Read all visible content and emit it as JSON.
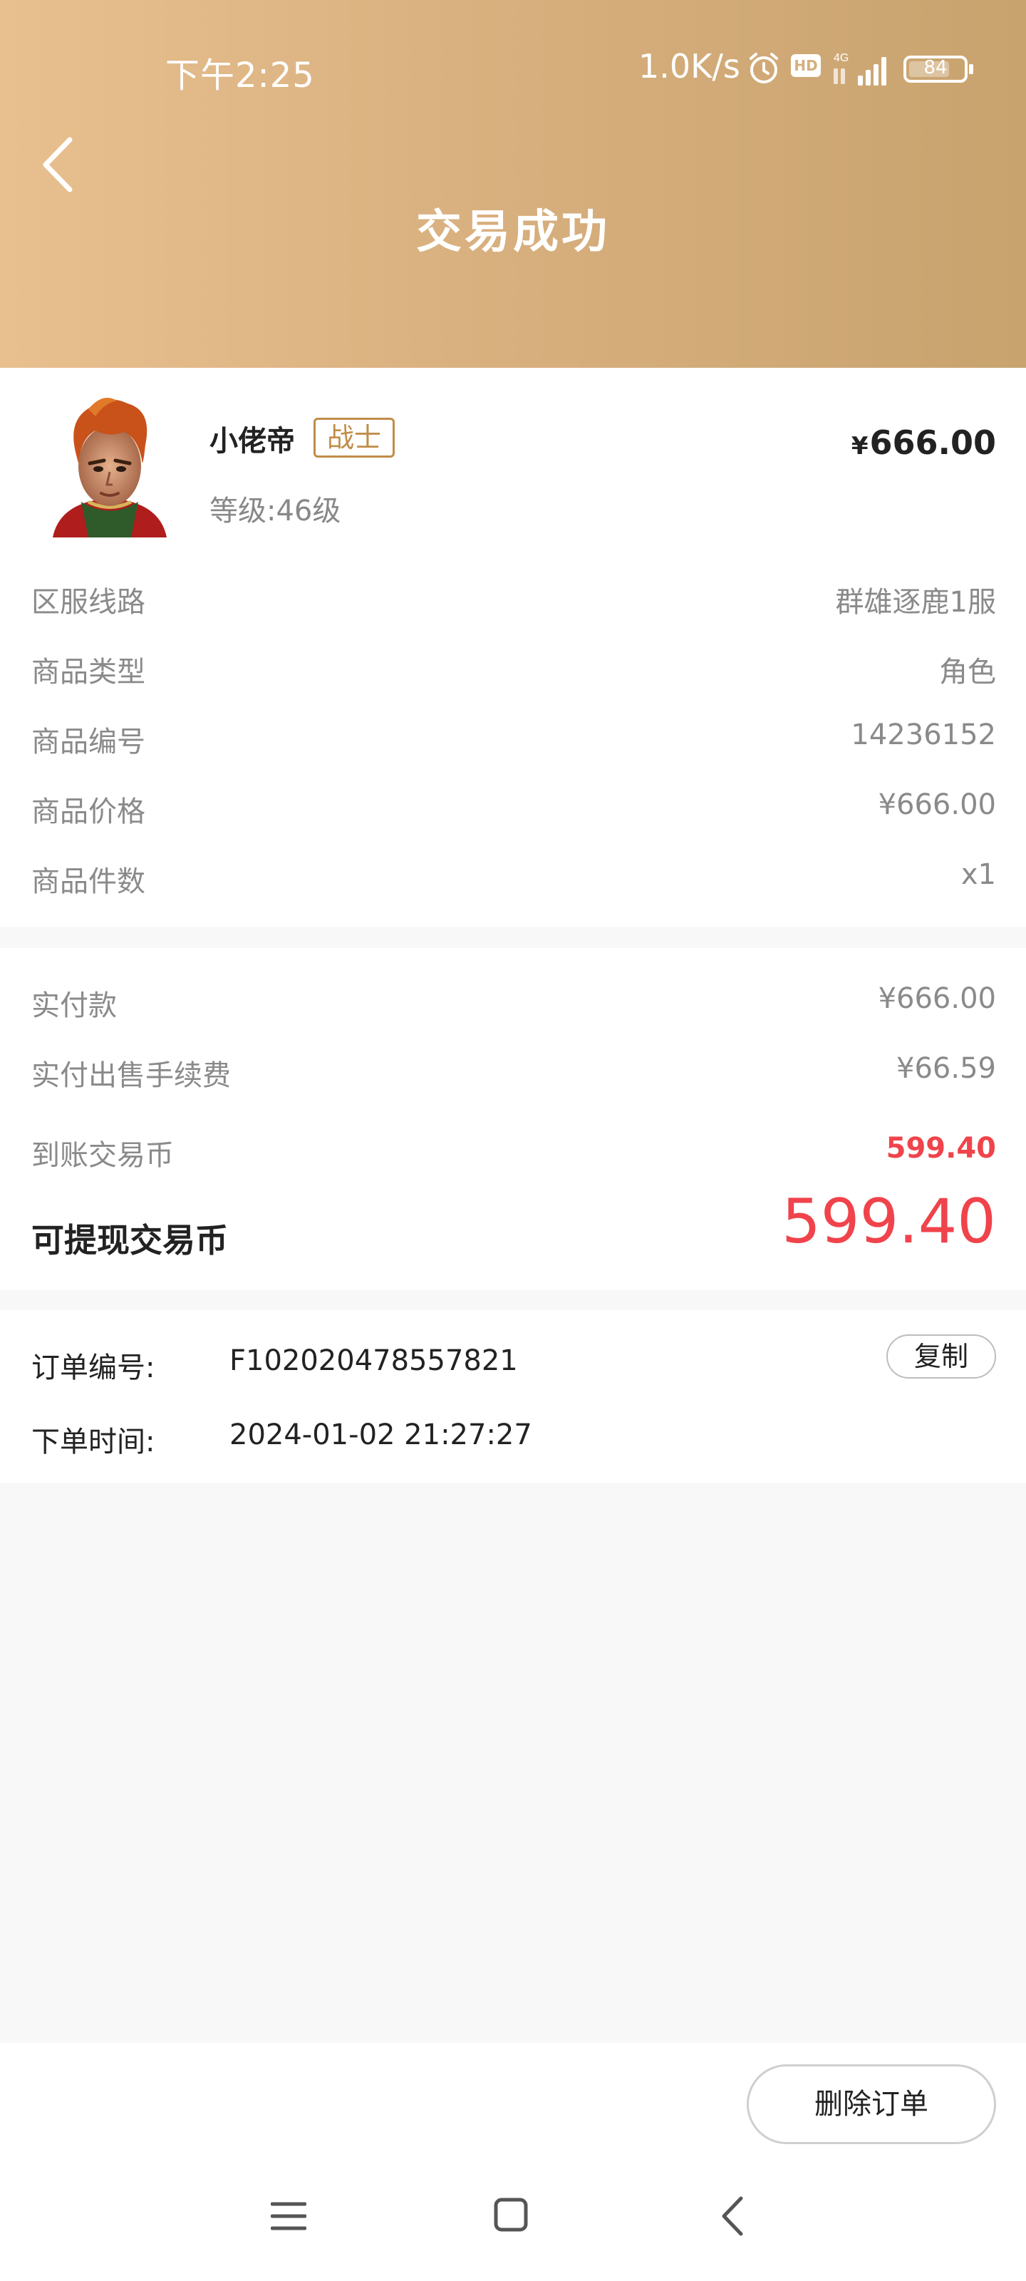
{
  "status_bar": {
    "time": "下午2:25",
    "net_speed": "1.0K/s",
    "hd_label": "HD",
    "network_label": "4G",
    "battery": "84"
  },
  "header": {
    "title": "交易成功"
  },
  "product": {
    "role_name": "小佬帝",
    "class_badge": "战士",
    "level": "等级:46级",
    "price_symbol": "¥",
    "price": "666.00",
    "details": [
      {
        "label": "区服线路",
        "value": "群雄逐鹿1服"
      },
      {
        "label": "商品类型",
        "value": "角色"
      },
      {
        "label": "商品编号",
        "value": "14236152"
      },
      {
        "label": "商品价格",
        "value": "¥666.00"
      },
      {
        "label": "商品件数",
        "value": "x1"
      }
    ]
  },
  "payment": {
    "paid_label": "实付款",
    "paid_value": "¥666.00",
    "fee_label": "实付出售手续费",
    "fee_value": "¥66.59",
    "received_label": "到账交易币",
    "received_value": "599.40",
    "withdrawable_label": "可提现交易币",
    "withdrawable_value": "599.40"
  },
  "order": {
    "number_label": "订单编号:",
    "number_value": "F102020478557821",
    "copy_label": "复制",
    "time_label": "下单时间:",
    "time_value": "2024-01-02 21:27:27"
  },
  "actions": {
    "delete_label": "删除订单"
  },
  "icons": [
    "back-arrow-icon",
    "alarm-icon",
    "signal-icon",
    "battery-icon",
    "menu-icon",
    "home-icon",
    "nav-back-icon"
  ],
  "colors": {
    "header_gradient_start": "#e8c08f",
    "header_gradient_end": "#c8a36e",
    "accent_red": "#f0434b",
    "badge_gold": "#c08d48"
  }
}
